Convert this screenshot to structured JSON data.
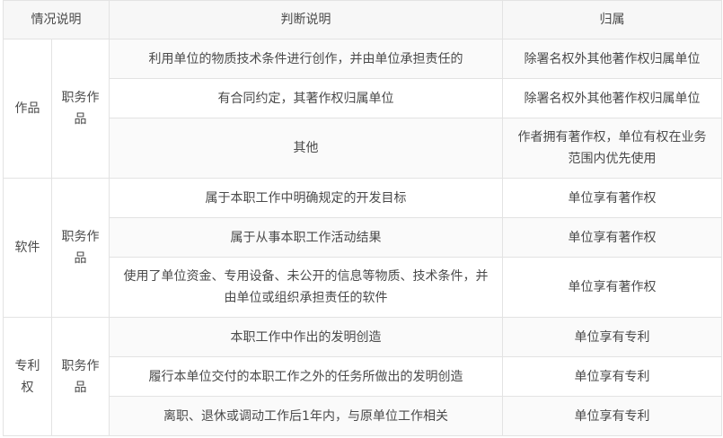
{
  "table": {
    "headers": {
      "situation": "情况说明",
      "judgment": "判断说明",
      "ownership": "归属"
    },
    "groups": [
      {
        "category": "作品",
        "subcategory": "职务作品",
        "rows": [
          {
            "judgment": "利用单位的物质技术条件进行创作，并由单位承担责任的",
            "ownership": "除署名权外其他著作权归属单位"
          },
          {
            "judgment": "有合同约定，其著作权归属单位",
            "ownership": "除署名权外其他著作权归属单位"
          },
          {
            "judgment": "其他",
            "ownership": "作者拥有著作权，单位有权在业务范围内优先使用"
          }
        ]
      },
      {
        "category": "软件",
        "subcategory": "职务作品",
        "rows": [
          {
            "judgment": "属于本职工作中明确规定的开发目标",
            "ownership": "单位享有著作权"
          },
          {
            "judgment": "属于从事本职工作活动结果",
            "ownership": "单位享有著作权"
          },
          {
            "judgment": "使用了单位资金、专用设备、未公开的信息等物质、技术条件，并由单位或组织承担责任的软件",
            "ownership": "单位享有著作权"
          }
        ]
      },
      {
        "category": "专利权",
        "subcategory": "职务作品",
        "rows": [
          {
            "judgment": "本职工作中作出的发明创造",
            "ownership": "单位享有专利"
          },
          {
            "judgment": "履行本单位交付的本职工作之外的任务所做出的发明创造",
            "ownership": "单位享有专利"
          },
          {
            "judgment": "离职、退休或调动工作后1年内，与原单位工作相关",
            "ownership": "单位享有专利"
          }
        ]
      }
    ]
  }
}
